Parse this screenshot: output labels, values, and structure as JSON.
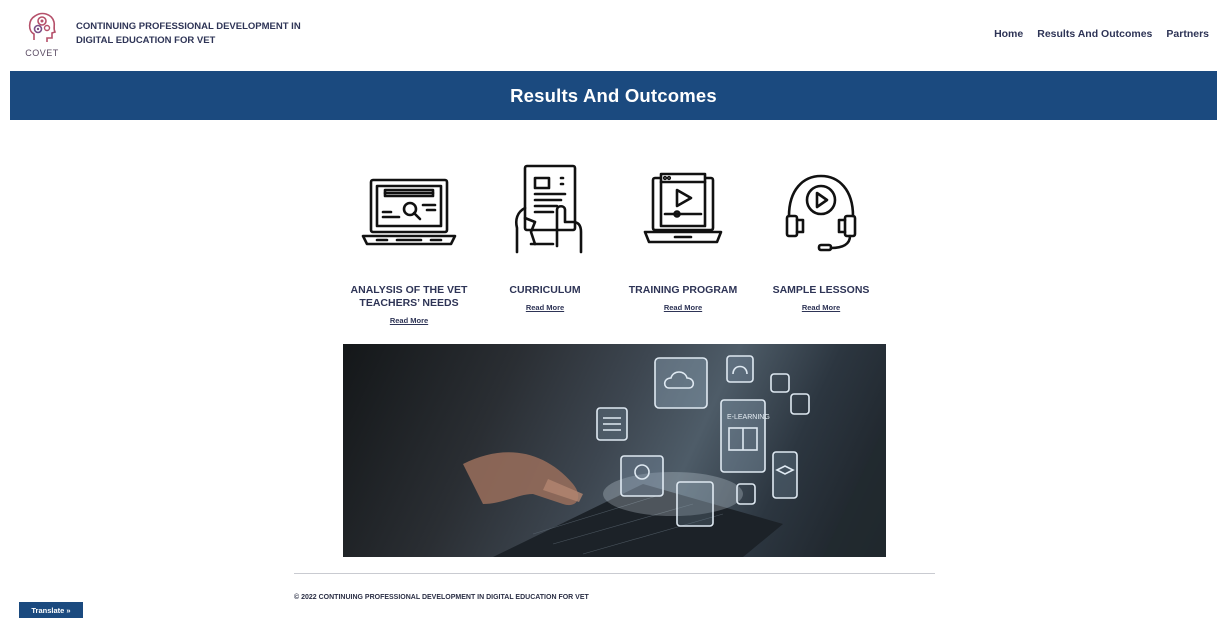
{
  "header": {
    "logo_text": "COVET",
    "site_title": "CONTINUING PROFESSIONAL DEVELOPMENT IN DIGITAL EDUCATION FOR VET",
    "nav": [
      {
        "label": "Home"
      },
      {
        "label": "Results And Outcomes"
      },
      {
        "label": "Partners"
      }
    ]
  },
  "banner": {
    "title": "Results And Outcomes"
  },
  "cards": [
    {
      "icon": "laptop-search-icon",
      "label": "ANALYSIS OF THE VET TEACHERS’ NEEDS",
      "link": "Read More"
    },
    {
      "icon": "document-touch-icon",
      "label": "CURRICULUM",
      "link": "Read More"
    },
    {
      "icon": "laptop-video-icon",
      "label": "TRAINING PROGRAM",
      "link": "Read More"
    },
    {
      "icon": "headset-play-icon",
      "label": "SAMPLE LESSONS",
      "link": "Read More"
    }
  ],
  "hero": {
    "overlay_text": "E-LEARNING"
  },
  "footer": {
    "copyright": "© 2022 CONTINUING PROFESSIONAL DEVELOPMENT IN DIGITAL EDUCATION FOR VET"
  },
  "translate": {
    "label": "Translate »"
  },
  "colors": {
    "primary": "#1b4a7f",
    "text": "#2e3456"
  }
}
